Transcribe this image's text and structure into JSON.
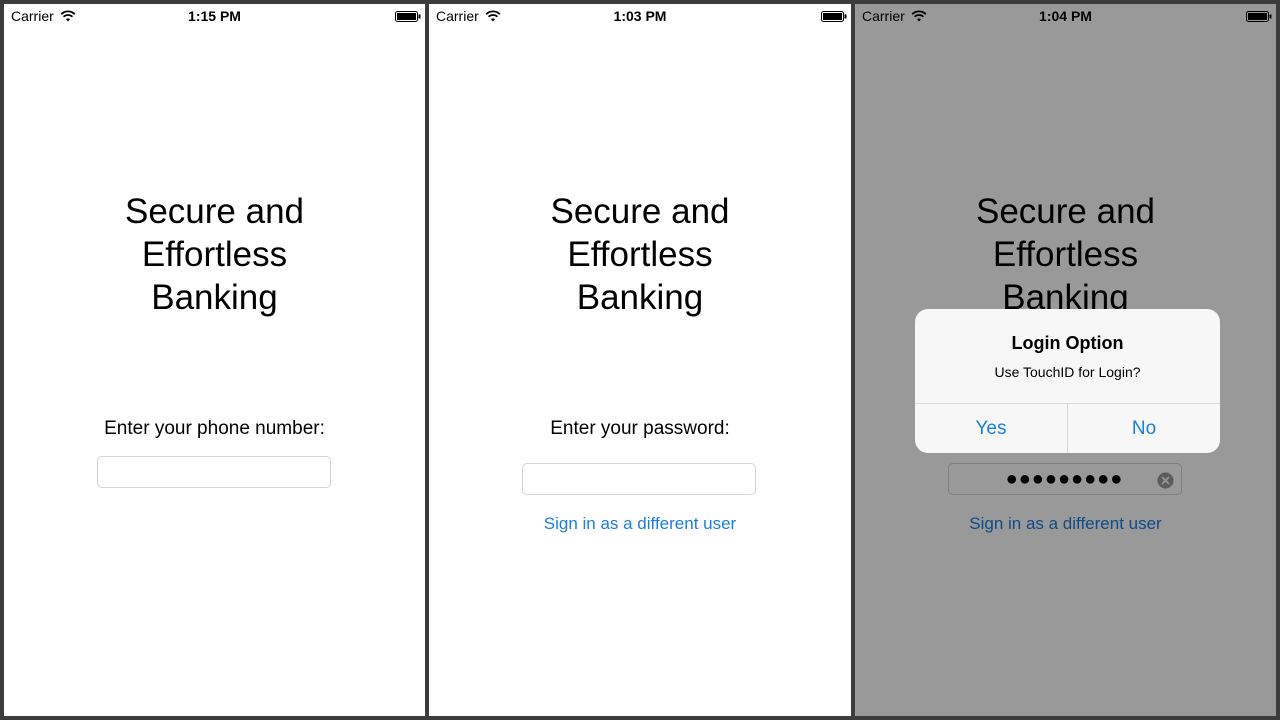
{
  "colors": {
    "link": "#1a7ee0",
    "dim_overlay": "rgba(0,0,0,0.4)"
  },
  "icons": {
    "wifi": "wifi-icon",
    "battery": "battery-icon",
    "clear": "clear-text-icon"
  },
  "screens": [
    {
      "status": {
        "carrier": "Carrier",
        "time": "1:15 PM"
      },
      "headline": [
        "Secure and",
        "Effortless",
        "Banking"
      ],
      "prompt": "Enter your phone number:",
      "field_value": ""
    },
    {
      "status": {
        "carrier": "Carrier",
        "time": "1:03 PM"
      },
      "headline": [
        "Secure and",
        "Effortless",
        "Banking"
      ],
      "prompt": "Enter your password:",
      "field_value": "",
      "link": "Sign in as a different user"
    },
    {
      "status": {
        "carrier": "Carrier",
        "time": "1:04 PM"
      },
      "headline": [
        "Secure and",
        "Effortless",
        "Banking"
      ],
      "field_value": "●●●●●●●●●",
      "link": "Sign in as a different user",
      "alert": {
        "title": "Login Option",
        "message": "Use TouchID for Login?",
        "buttons": [
          "Yes",
          "No"
        ]
      }
    }
  ]
}
